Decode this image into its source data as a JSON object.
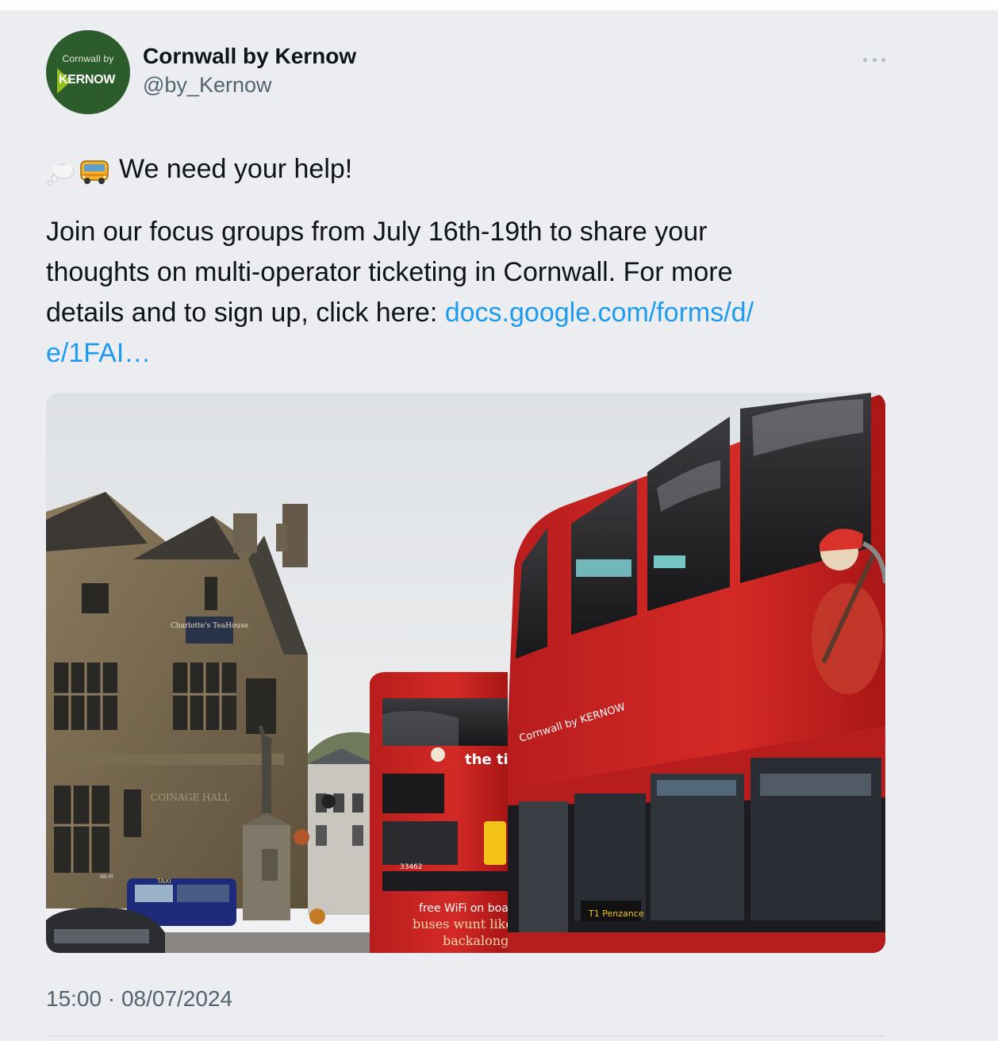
{
  "author": {
    "display_name": "Cornwall by Kernow",
    "handle": "@by_Kernow",
    "avatar": {
      "top_text": "Cornwall by",
      "main_text": "KERNOW",
      "background": "#2c5c2c",
      "chevron_color": "#93c01f"
    }
  },
  "menu": {
    "icon": "more-horizontal-icon"
  },
  "tweet": {
    "emoji_icons": [
      "thought-balloon-icon",
      "bus-icon"
    ],
    "headline": "We need your help!",
    "body": "Join our focus groups from July 16th-19th to share your\nthoughts on multi-operator ticketing in Cornwall. For more\ndetails and to sign up, click here: ",
    "link_text": "docs.google.com/forms/d/\ne/1FAI…",
    "link_color": "#1d9bf0"
  },
  "media": {
    "image_label": "photo-buses-town-square",
    "signs": {
      "teahouse": "Charlotte's TeaHouse",
      "hall": "COINAGE HALL",
      "taxi": "TAXI",
      "wifi": "Wi-Fi",
      "fleet_number": "33462",
      "brand": "the tinner",
      "operator": "Cornwall by KERNOW",
      "wifi_ad": "free WiFi on boa",
      "slogan_1": "buses wunt like t",
      "slogan_2": "backalong",
      "route": "T1 Penzance"
    }
  },
  "meta": {
    "timestamp": "15:00 · 08/07/2024"
  }
}
